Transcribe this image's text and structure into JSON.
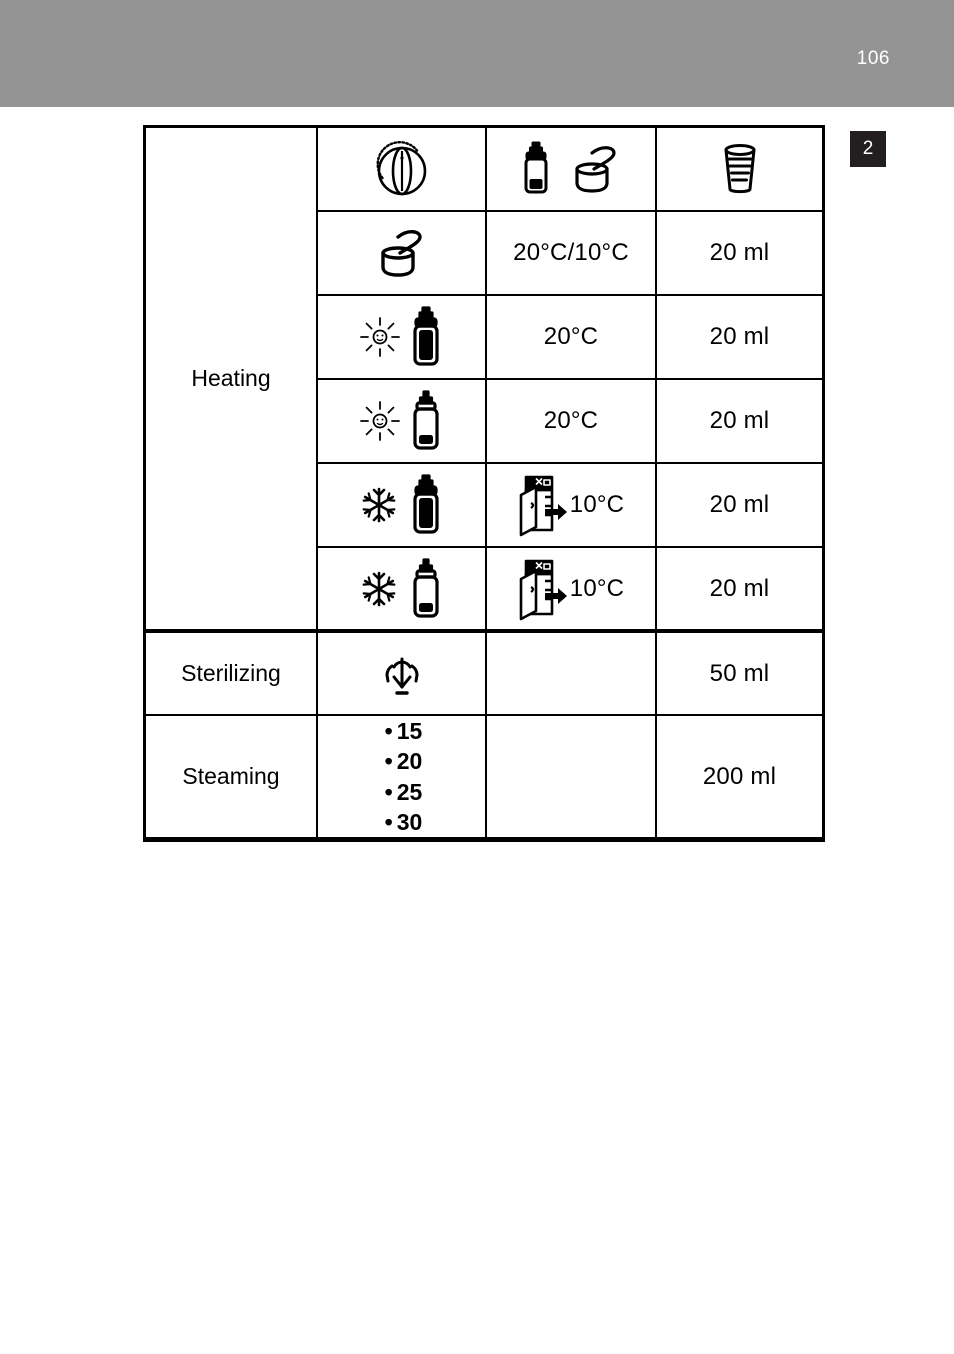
{
  "header": {
    "page_number": "106",
    "band_color": "#949494"
  },
  "chapter_badge": {
    "label": "2",
    "background": "#231f20",
    "text_color": "#ffffff"
  },
  "table": {
    "columns": [
      {
        "id": "mode",
        "header_icon": "",
        "header_label": ""
      },
      {
        "id": "setting",
        "header_icon": "control-knob-icon",
        "header_label": ""
      },
      {
        "id": "temperature",
        "header_icon": "bottle-and-food-jar-icon",
        "header_label": ""
      },
      {
        "id": "water",
        "header_icon": "measuring-cup-icon",
        "header_label": ""
      }
    ],
    "groups": [
      {
        "label": "Heating",
        "rows": [
          {
            "setting_icon": "food-jar-with-spoon-icon",
            "temperature": "20°C/10°C",
            "temperature_icon": "",
            "water": "20 ml"
          },
          {
            "setting_icon": "sun-and-full-bottle-icon",
            "temperature": "20°C",
            "temperature_icon": "",
            "water": "20 ml"
          },
          {
            "setting_icon": "sun-and-low-bottle-icon",
            "temperature": "20°C",
            "temperature_icon": "",
            "water": "20 ml"
          },
          {
            "setting_icon": "snowflake-and-full-bottle-icon",
            "temperature": "10°C",
            "temperature_icon": "refrigerator-arrow-icon",
            "water": "20 ml"
          },
          {
            "setting_icon": "snowflake-and-low-bottle-icon",
            "temperature": "10°C",
            "temperature_icon": "refrigerator-arrow-icon",
            "water": "20 ml"
          }
        ]
      },
      {
        "label": "Sterilizing",
        "rows": [
          {
            "setting_icon": "steam-sterilize-icon",
            "temperature": "",
            "temperature_icon": "",
            "water": "50 ml"
          }
        ]
      },
      {
        "label": "Steaming",
        "rows": [
          {
            "setting_icon": "",
            "setting_list": [
              "15",
              "20",
              "25",
              "30"
            ],
            "bullet": "•",
            "temperature": "",
            "temperature_icon": "",
            "water": "200 ml"
          }
        ]
      }
    ]
  }
}
